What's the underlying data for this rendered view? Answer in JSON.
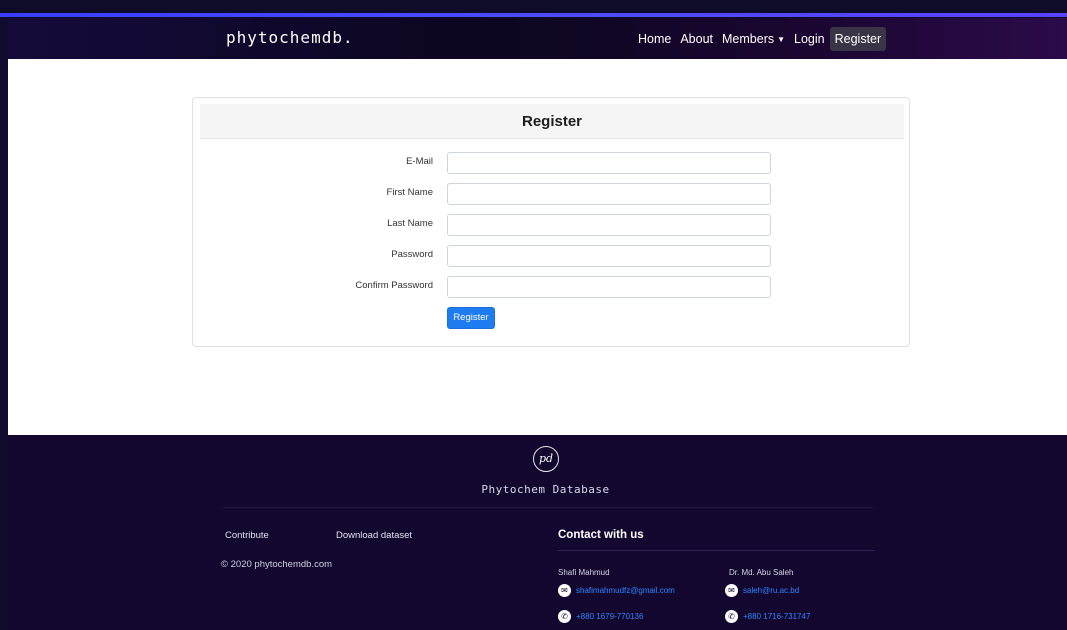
{
  "navbar": {
    "brand": "phytochemdb.",
    "links": [
      "Home",
      "About",
      "Members",
      "Login",
      "Register"
    ]
  },
  "form": {
    "title": "Register",
    "fields": [
      {
        "label": "E-Mail",
        "value": ""
      },
      {
        "label": "First Name",
        "value": ""
      },
      {
        "label": "Last Name",
        "value": ""
      },
      {
        "label": "Password",
        "value": ""
      },
      {
        "label": "Confirm Password",
        "value": ""
      }
    ],
    "submit_label": "Register"
  },
  "footer": {
    "logo_text": "pd",
    "title": "Phytochem Database",
    "links": [
      "Contribute",
      "Download dataset"
    ],
    "copyright": "© 2020 phytochemdb.com",
    "contact_heading": "Contact with us",
    "contacts": [
      {
        "name": "Shafi Mahmud",
        "email": "shafimahmudfz@gmail.com",
        "phone": "+880 1679-770136"
      },
      {
        "name": "Dr. Md. Abu Saleh",
        "email": "saleh@ru.ac.bd",
        "phone": "+880 1716-731747"
      }
    ]
  },
  "colors": {
    "accent": "#1e7bf0",
    "navbar_dark": "#0c0620",
    "footer_bg": "#13072f",
    "link_blue": "#2f86ff"
  }
}
